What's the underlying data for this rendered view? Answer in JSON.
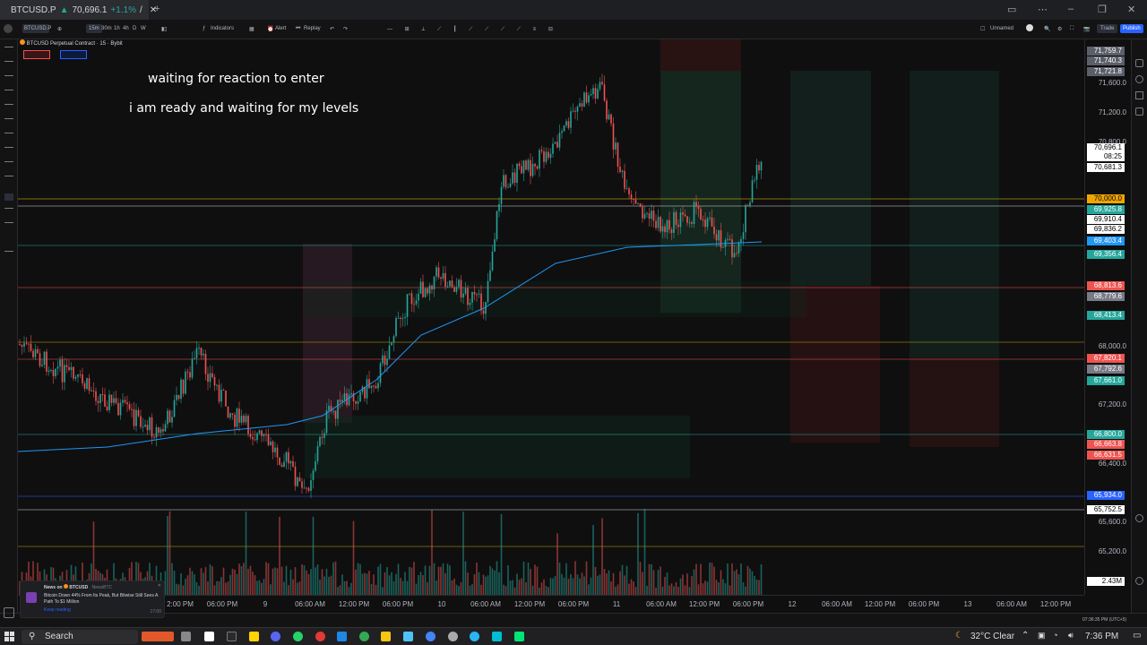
{
  "tab": {
    "symbol": "BTCUSD.P",
    "price": "70,696.1",
    "change": "+1.1%",
    "separator": "/"
  },
  "toolbar": {
    "symbol": "BTCUSD.P",
    "intervals": [
      "15m",
      "30m",
      "1h",
      "4h",
      "D",
      "W"
    ],
    "indicators_label": "Indicators",
    "alert_label": "Alert",
    "replay_label": "Replay",
    "layout_name": "Unnamed",
    "trade_label": "Trade",
    "publish_label": "Publish"
  },
  "legend": {
    "title": "BTCUSD Perpetual Contract · 15 · Bybit"
  },
  "overlay": {
    "line1": "waiting for reaction to enter",
    "line2": "i am ready and waiting for my levels"
  },
  "price_axis": {
    "labels": [
      "71,600.0",
      "71,200.0",
      "70,800.0",
      "68,000.0",
      "67,200.0",
      "66,400.0",
      "65,600.0",
      "65,200.0"
    ],
    "tags": [
      {
        "text": "71,759.7",
        "color": "#5b5f6a"
      },
      {
        "text": "71,740.3",
        "color": "#5b5f6a"
      },
      {
        "text": "71,721.8",
        "color": "#5b5f6a"
      },
      {
        "text": "70,696.1",
        "color": "#ffffff"
      },
      {
        "text": "08:25",
        "color": "#ffffff"
      },
      {
        "text": "70,681.3",
        "color": "#ffffff"
      },
      {
        "text": "70,000.0",
        "color": "#f0a500"
      },
      {
        "text": "69,925.8",
        "color": "#26a69a"
      },
      {
        "text": "69,910.4",
        "color": "#ffffff"
      },
      {
        "text": "69,836.2",
        "color": "#ffffff"
      },
      {
        "text": "69,403.4",
        "color": "#2196f3"
      },
      {
        "text": "69,356.4",
        "color": "#26a69a"
      },
      {
        "text": "68,813.6",
        "color": "#ef5350"
      },
      {
        "text": "68,779.6",
        "color": "#787b86"
      },
      {
        "text": "68,413.4",
        "color": "#26a69a"
      },
      {
        "text": "67,820.1",
        "color": "#ef5350"
      },
      {
        "text": "67,792.6",
        "color": "#787b86"
      },
      {
        "text": "67,661.0",
        "color": "#26a69a"
      },
      {
        "text": "66,800.0",
        "color": "#26a69a"
      },
      {
        "text": "66,663.8",
        "color": "#ef5350"
      },
      {
        "text": "66,631.5",
        "color": "#ef5350"
      },
      {
        "text": "65,934.0",
        "color": "#2962ff"
      },
      {
        "text": "65,752.5",
        "color": "#ffffff"
      },
      {
        "text": "2.43M",
        "color": "#ffffff"
      }
    ]
  },
  "time_axis": {
    "labels": [
      "2:00 PM",
      "06:00 PM",
      "9",
      "06:00 AM",
      "12:00 PM",
      "06:00 PM",
      "10",
      "06:00 AM",
      "12:00 PM",
      "06:00 PM",
      "11",
      "06:00 AM",
      "12:00 PM",
      "06:00 PM",
      "12",
      "06:00 AM",
      "12:00 PM",
      "06:00 PM",
      "13",
      "06:00 AM",
      "12:00 PM"
    ]
  },
  "news": {
    "header": "News on",
    "symbol": "BTCUSD",
    "source": "· NewsBTC",
    "headline": "Bitcoin Down 44% From Its Peak, But Bitwise Still Sees A Path To $1 Million",
    "action": "Keep reading",
    "time": "17:00"
  },
  "taskbar": {
    "search_placeholder": "Search",
    "weather": "32°C  Clear",
    "time": "7:36 PM"
  },
  "footer": {
    "clock": "07:36:35 PM (UTC+5)"
  },
  "colors": {
    "up": "#26a69a",
    "down": "#ef5350",
    "yellow_level": "#f0c000",
    "blue_vwap": "#2196f3"
  }
}
